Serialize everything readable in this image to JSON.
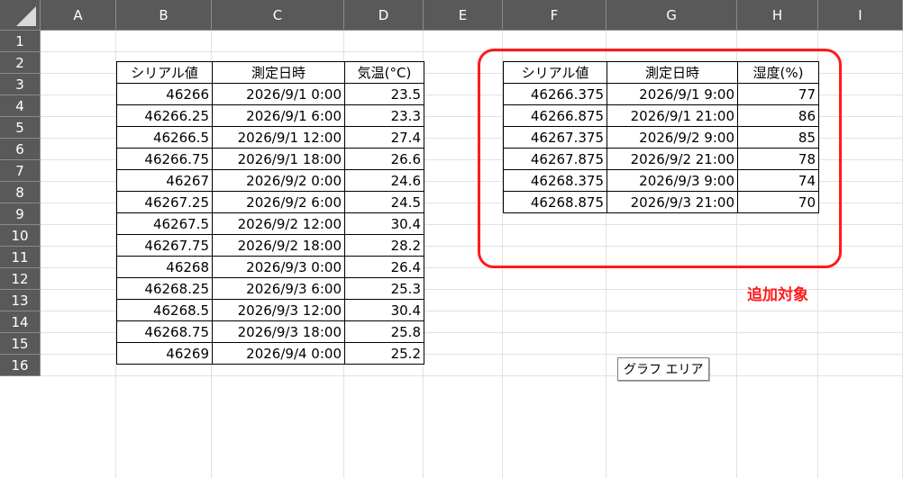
{
  "columns": [
    "A",
    "B",
    "C",
    "D",
    "E",
    "F",
    "G",
    "H",
    "I"
  ],
  "rows": [
    "1",
    "2",
    "3",
    "4",
    "5",
    "6",
    "7",
    "8",
    "9",
    "10",
    "11",
    "12",
    "13",
    "14",
    "15",
    "16"
  ],
  "temperature_table": {
    "headers": [
      "シリアル値",
      "測定日時",
      "気温(°C)"
    ],
    "rows": [
      [
        "46266",
        "2026/9/1 0:00",
        "23.5"
      ],
      [
        "46266.25",
        "2026/9/1 6:00",
        "23.3"
      ],
      [
        "46266.5",
        "2026/9/1 12:00",
        "27.4"
      ],
      [
        "46266.75",
        "2026/9/1 18:00",
        "26.6"
      ],
      [
        "46267",
        "2026/9/2 0:00",
        "24.6"
      ],
      [
        "46267.25",
        "2026/9/2 6:00",
        "24.5"
      ],
      [
        "46267.5",
        "2026/9/2 12:00",
        "30.4"
      ],
      [
        "46267.75",
        "2026/9/2 18:00",
        "28.2"
      ],
      [
        "46268",
        "2026/9/3 0:00",
        "26.4"
      ],
      [
        "46268.25",
        "2026/9/3 6:00",
        "25.3"
      ],
      [
        "46268.5",
        "2026/9/3 12:00",
        "30.4"
      ],
      [
        "46268.75",
        "2026/9/3 18:00",
        "25.8"
      ],
      [
        "46269",
        "2026/9/4 0:00",
        "25.2"
      ]
    ]
  },
  "humidity_table": {
    "headers": [
      "シリアル値",
      "測定日時",
      "湿度(%)"
    ],
    "rows": [
      [
        "46266.375",
        "2026/9/1 9:00",
        "77"
      ],
      [
        "46266.875",
        "2026/9/1 21:00",
        "86"
      ],
      [
        "46267.375",
        "2026/9/2 9:00",
        "85"
      ],
      [
        "46267.875",
        "2026/9/2 21:00",
        "78"
      ],
      [
        "46268.375",
        "2026/9/3 9:00",
        "74"
      ],
      [
        "46268.875",
        "2026/9/3 21:00",
        "70"
      ]
    ]
  },
  "annotation": {
    "label": "追加対象",
    "color": "#ff1a1a"
  },
  "chart_tooltip": "グラフ エリア"
}
